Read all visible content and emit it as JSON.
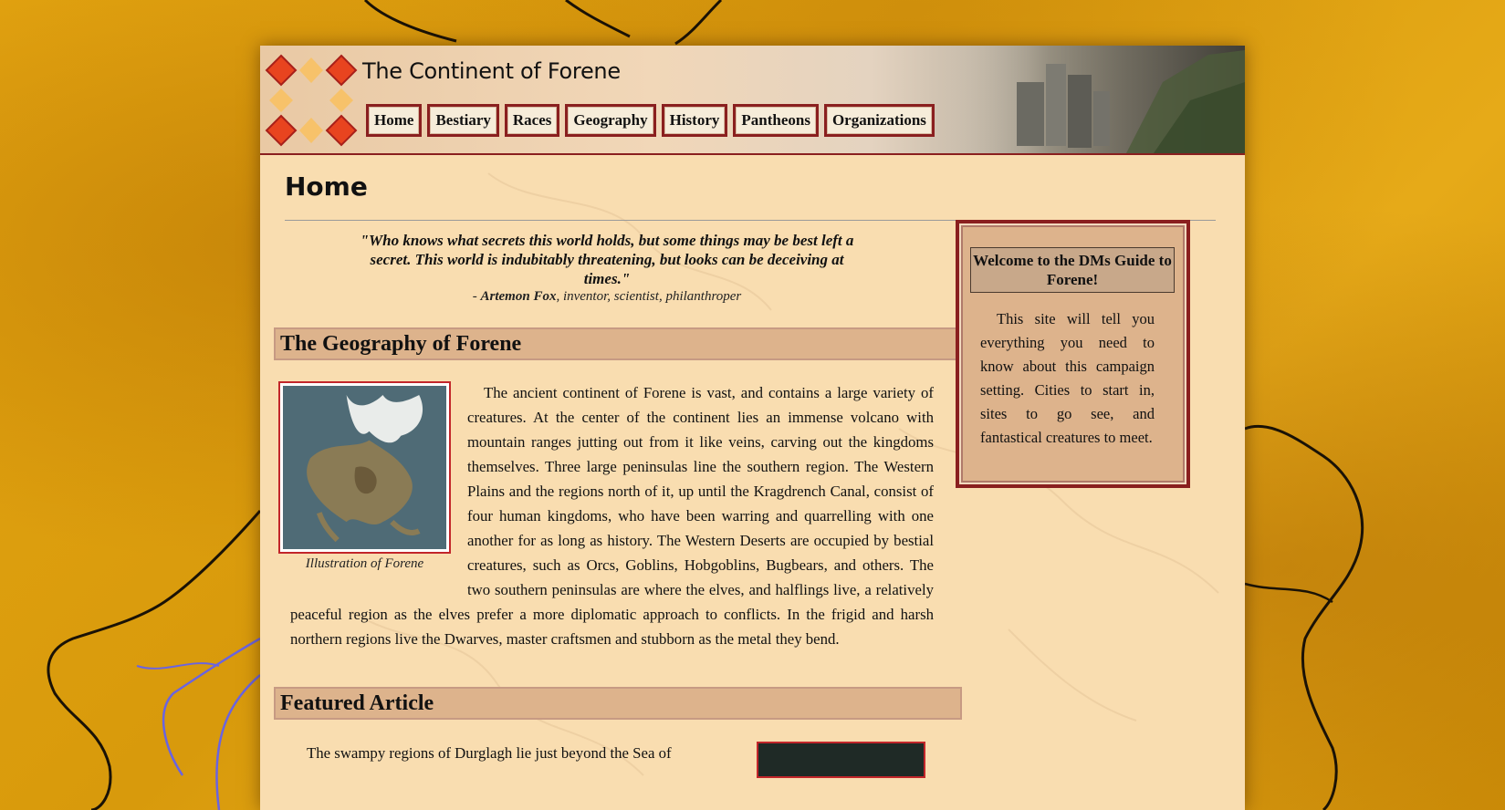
{
  "site": {
    "title": "The Continent of Forene"
  },
  "nav": {
    "items": [
      {
        "label": "Home"
      },
      {
        "label": "Bestiary"
      },
      {
        "label": "Races"
      },
      {
        "label": "Geography"
      },
      {
        "label": "History"
      },
      {
        "label": "Pantheons"
      },
      {
        "label": "Organizations"
      }
    ]
  },
  "main": {
    "page_title": "Home",
    "quote": {
      "text": "\"Who knows what secrets this world holds, but some things may be best left a secret. This world is indubitably threatening, but looks can be deceiving at times.\"",
      "attribution_prefix": "- ",
      "author": "Artemon Fox",
      "author_desc": ", inventor, scientist, philanthroper"
    },
    "geography": {
      "heading": "The Geography of Forene",
      "image_caption": "Illustration of Forene",
      "body": "The ancient continent of Forene is vast, and contains a large variety of creatures. At the center of the continent lies an immense volcano with mountain ranges jutting out from it like veins, carving out the kingdoms themselves. Three large peninsulas line the southern region. The Western Plains and the regions north of it, up until the Kragdrench Canal, consist of four human kingdoms, who have been warring and quarrelling with one another for as long as history. The Western Deserts are occupied by bestial creatures, such as Orcs, Goblins, Hobgoblins, Bugbears, and others. The two southern peninsulas are where the elves, and halflings live, a relatively peaceful region as the elves prefer a more diplomatic approach to conflicts. In the frigid and harsh northern regions live the Dwarves, master craftsmen and stubborn as the metal they bend."
    },
    "featured": {
      "heading": "Featured Article",
      "body": "The swampy regions of Durglagh lie just beyond the Sea of"
    }
  },
  "sidebar": {
    "title": "Welcome to the DMs Guide to Forene!",
    "body": "This site will tell you everything you need to know about this campaign setting. Cities to start in, sites to go see, and fantastical creatures to meet."
  },
  "colors": {
    "background": "#e3a410",
    "page": "#f9ddb0",
    "accent_border": "#8a1f1f",
    "section_head": "#ddb38c",
    "image_border": "#c2262a"
  }
}
